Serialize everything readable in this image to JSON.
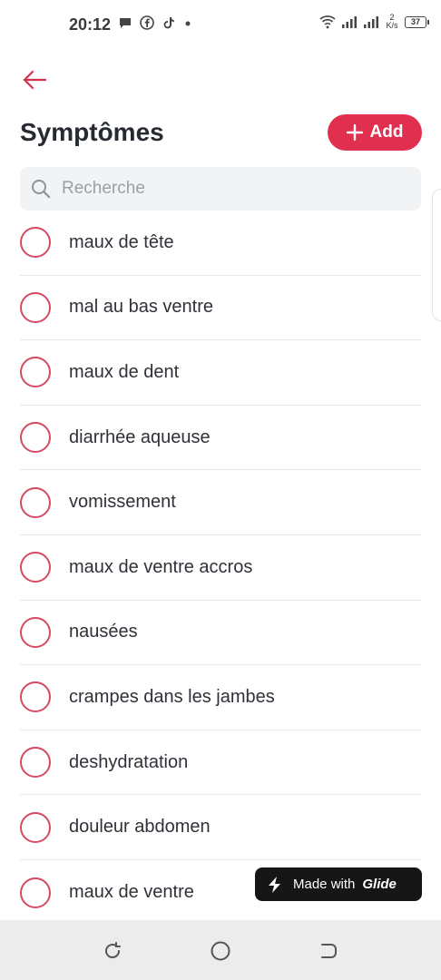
{
  "status_bar": {
    "time": "20:12",
    "net_speed_value": "2",
    "net_speed_unit": "K/s",
    "battery": "37"
  },
  "header": {
    "title": "Symptômes",
    "add_label": "Add"
  },
  "search": {
    "placeholder": "Recherche"
  },
  "items": [
    {
      "label": "maux de tête"
    },
    {
      "label": "mal au bas ventre"
    },
    {
      "label": "maux de dent"
    },
    {
      "label": "diarrhée aqueuse"
    },
    {
      "label": "vomissement"
    },
    {
      "label": "maux de ventre accros"
    },
    {
      "label": "nausées"
    },
    {
      "label": "crampes dans les jambes"
    },
    {
      "label": "deshydratation"
    },
    {
      "label": "douleur abdomen"
    },
    {
      "label": "maux de ventre"
    }
  ],
  "badge": {
    "prefix": "Made with",
    "brand": "Glide"
  },
  "colors": {
    "accent": "#e1304f",
    "radio_border": "#d44a62",
    "badge_bg": "#161616"
  },
  "icons": [
    "back-arrow-icon",
    "plus-icon",
    "search-icon",
    "glide-logo-icon",
    "recent-apps-icon",
    "home-icon",
    "back-nav-icon"
  ]
}
